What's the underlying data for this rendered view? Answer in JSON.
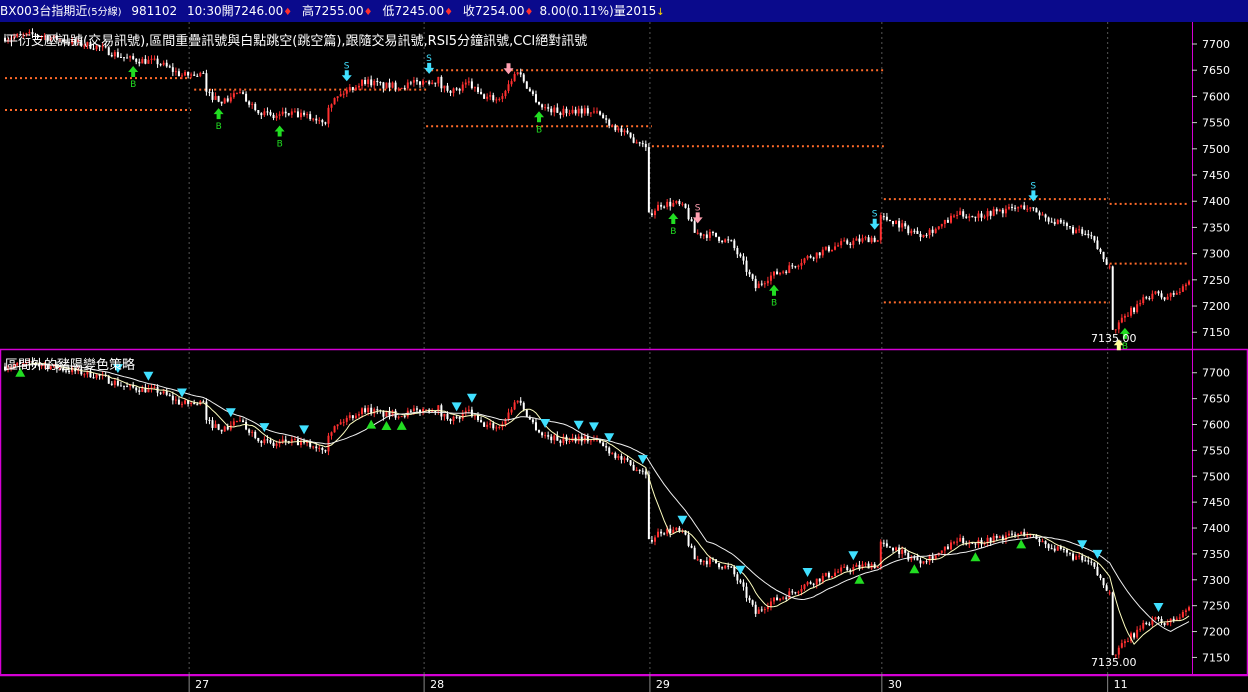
{
  "header": {
    "symbol": "BX003台指期近",
    "interval": "(5分線)",
    "date": "981102",
    "time": "10:30",
    "open_label": "開",
    "open": "7246.00",
    "high_label": "高",
    "high": "7255.00",
    "low_label": "低",
    "low": "7245.00",
    "close_label": "收",
    "close": "7254.00",
    "change": "8.00",
    "change_pct": "(0.11%)",
    "volume_label": "量",
    "volume": "2015"
  },
  "panels": {
    "top_title": "平衍支壓訊號(交易訊號),區間重疊訊號與白點跳空(跳空篇),跟隨交易訊號,RSI5分鐘訊號,CCI絕對訊號",
    "bottom_title": "區間外的豬陽變色策略",
    "min_label_top": "7135.00",
    "min_label_bottom": "7135.00"
  },
  "colors": {
    "background": "#000000",
    "header_bg": "#0a0a8c",
    "frame": "#d400d4",
    "up_bar": "#ff3030",
    "down_bar": "#ffffff",
    "level_line": "#ff6a2a",
    "buy_arrow": "#22dd22",
    "sell_arrow": "#40e0ff",
    "sell_arrow_alt": "#ff9fb0",
    "ma_fast": "#ffffc0",
    "ma_slow": "#f0f0f0",
    "triangle_up": "#22dd22",
    "triangle_down": "#40e0ff",
    "axis_text": "#ffffff"
  },
  "chart_data": [
    {
      "type": "candlestick",
      "title": "平衍支壓訊號(交易訊號),區間重疊訊號與白點跳空(跳空篇),跟隨交易訊號,RSI5分鐘訊號,CCI絕對訊號",
      "x_ticks": [
        "27",
        "28",
        "29",
        "30",
        "11"
      ],
      "y_ticks": [
        7700,
        7650,
        7600,
        7550,
        7500,
        7450,
        7400,
        7350,
        7300,
        7250,
        7200,
        7150
      ],
      "ylim": [
        7118,
        7742
      ],
      "price_path": [
        [
          0,
          7712
        ],
        [
          10,
          7718
        ],
        [
          20,
          7706
        ],
        [
          30,
          7695
        ],
        [
          40,
          7672
        ],
        [
          50,
          7665
        ],
        [
          58,
          7640
        ],
        [
          65,
          7642
        ],
        [
          66,
          7605
        ],
        [
          72,
          7590
        ],
        [
          76,
          7608
        ],
        [
          80,
          7590
        ],
        [
          84,
          7570
        ],
        [
          88,
          7560
        ],
        [
          92,
          7568
        ],
        [
          100,
          7560
        ],
        [
          105,
          7555
        ],
        [
          106,
          7585
        ],
        [
          112,
          7612
        ],
        [
          118,
          7630
        ],
        [
          124,
          7620
        ],
        [
          130,
          7620
        ],
        [
          137,
          7628
        ],
        [
          142,
          7632
        ],
        [
          143,
          7618
        ],
        [
          148,
          7610
        ],
        [
          152,
          7625
        ],
        [
          156,
          7600
        ],
        [
          162,
          7595
        ],
        [
          168,
          7650
        ],
        [
          172,
          7610
        ],
        [
          176,
          7580
        ],
        [
          182,
          7570
        ],
        [
          188,
          7575
        ],
        [
          194,
          7568
        ],
        [
          198,
          7550
        ],
        [
          205,
          7520
        ],
        [
          210,
          7510
        ],
        [
          211,
          7375
        ],
        [
          215,
          7395
        ],
        [
          220,
          7395
        ],
        [
          223,
          7385
        ],
        [
          226,
          7340
        ],
        [
          232,
          7335
        ],
        [
          238,
          7320
        ],
        [
          242,
          7280
        ],
        [
          246,
          7235
        ],
        [
          250,
          7255
        ],
        [
          256,
          7270
        ],
        [
          262,
          7290
        ],
        [
          268,
          7305
        ],
        [
          274,
          7318
        ],
        [
          280,
          7325
        ],
        [
          284,
          7330
        ],
        [
          286,
          7325
        ],
        [
          287,
          7370
        ],
        [
          292,
          7360
        ],
        [
          296,
          7345
        ],
        [
          300,
          7338
        ],
        [
          306,
          7350
        ],
        [
          312,
          7375
        ],
        [
          318,
          7372
        ],
        [
          324,
          7380
        ],
        [
          330,
          7385
        ],
        [
          334,
          7390
        ],
        [
          338,
          7380
        ],
        [
          344,
          7360
        ],
        [
          350,
          7345
        ],
        [
          356,
          7330
        ],
        [
          360,
          7290
        ],
        [
          362,
          7280
        ],
        [
          363,
          7150
        ],
        [
          368,
          7185
        ],
        [
          372,
          7205
        ],
        [
          376,
          7225
        ],
        [
          380,
          7215
        ],
        [
          385,
          7228
        ],
        [
          388,
          7248
        ]
      ],
      "support_resistance_levels": [
        {
          "x_start": 0,
          "x_end": 61,
          "value": 7635
        },
        {
          "x_start": 0,
          "x_end": 61,
          "value": 7574
        },
        {
          "x_start": 62,
          "x_end": 138,
          "value": 7613
        },
        {
          "x_start": 138,
          "x_end": 288,
          "value": 7650
        },
        {
          "x_start": 138,
          "x_end": 212,
          "value": 7543
        },
        {
          "x_start": 212,
          "x_end": 288,
          "value": 7505
        },
        {
          "x_start": 288,
          "x_end": 362,
          "value": 7404
        },
        {
          "x_start": 288,
          "x_end": 362,
          "value": 7207
        },
        {
          "x_start": 362,
          "x_end": 388,
          "value": 7395
        },
        {
          "x_start": 362,
          "x_end": 388,
          "value": 7281
        }
      ],
      "signals": [
        {
          "x": 42,
          "type": "buy",
          "label": "B"
        },
        {
          "x": 70,
          "type": "buy",
          "label": "B"
        },
        {
          "x": 90,
          "type": "buy",
          "label": "B"
        },
        {
          "x": 112,
          "type": "sell",
          "label": "S"
        },
        {
          "x": 139,
          "type": "sell",
          "label": "S"
        },
        {
          "x": 165,
          "type": "sell_alt",
          "label": ""
        },
        {
          "x": 175,
          "type": "buy",
          "label": "B"
        },
        {
          "x": 219,
          "type": "buy",
          "label": "B"
        },
        {
          "x": 227,
          "type": "sell_alt",
          "label": "S"
        },
        {
          "x": 252,
          "type": "buy",
          "label": "B"
        },
        {
          "x": 285,
          "type": "sell",
          "label": "S"
        },
        {
          "x": 337,
          "type": "sell",
          "label": "S"
        },
        {
          "x": 365,
          "type": "buy_alt",
          "label": ""
        },
        {
          "x": 367,
          "type": "buy",
          "label": "B"
        }
      ],
      "min_label": "7135.00"
    },
    {
      "type": "candlestick",
      "title": "區間外的豬陽變色策略",
      "x_ticks": [
        "27",
        "28",
        "29",
        "30",
        "11"
      ],
      "y_ticks": [
        7700,
        7650,
        7600,
        7550,
        7500,
        7450,
        7400,
        7350,
        7300,
        7250,
        7200,
        7150
      ],
      "ylim": [
        7118,
        7742
      ],
      "series": [
        {
          "name": "",
          "role": "fast_ma"
        },
        {
          "name": "",
          "role": "slow_ma"
        }
      ],
      "triangles_up_x": [
        5,
        120,
        125,
        130,
        280,
        298,
        318,
        333
      ],
      "triangles_down_x": [
        37,
        47,
        58,
        74,
        85,
        98,
        148,
        153,
        177,
        188,
        193,
        198,
        209,
        222,
        241,
        263,
        278,
        353,
        358,
        378
      ],
      "min_label": "7135.00"
    }
  ]
}
